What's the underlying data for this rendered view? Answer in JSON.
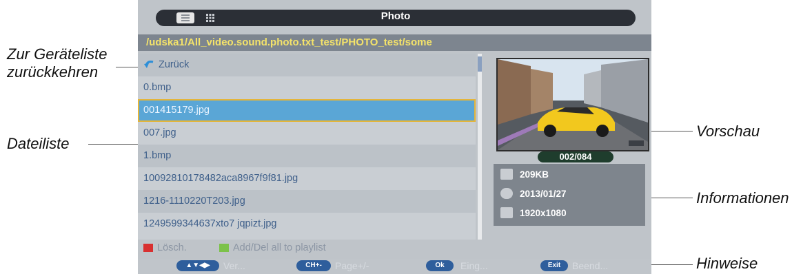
{
  "window": {
    "title": "Photo"
  },
  "path": "/udska1/All_video.sound.photo.txt_test/PHOTO_test/some",
  "file_list": [
    {
      "label": "Zurück",
      "type": "back"
    },
    {
      "label": "0.bmp"
    },
    {
      "label": "001415179.jpg",
      "selected": true
    },
    {
      "label": "007.jpg"
    },
    {
      "label": "1.bmp"
    },
    {
      "label": "10092810178482aca8967f9f81.jpg"
    },
    {
      "label": "1216-1110220T203.jpg"
    },
    {
      "label": "1249599344637xto7 jqpizt.jpg"
    }
  ],
  "preview": {
    "counter": "002/084"
  },
  "info": {
    "size": "209KB",
    "date": "2013/01/27",
    "resolution": "1920x1080"
  },
  "hints": {
    "red_label": "Lösch.",
    "green_label": "Add/Del all to playlist"
  },
  "footer": {
    "nav_button": "▲▼◀▶",
    "nav_label": "Ver...",
    "ch_button": "CH+-",
    "ch_label": "Page+/-",
    "ok_button": "Ok",
    "ok_label": "Eing...",
    "exit_button": "Exit",
    "exit_label": "Beend..."
  },
  "callouts": {
    "device_list_line1": "Zur Geräteliste",
    "device_list_line2": "zurückkehren",
    "file_list": "Dateiliste",
    "preview": "Vorschau",
    "info": "Informationen",
    "hints": "Hinweise"
  },
  "colors": {
    "selection": "#5aa6d6",
    "path_text": "#f4e36a",
    "red_key": "#d83030",
    "green_key": "#7cc24a"
  }
}
